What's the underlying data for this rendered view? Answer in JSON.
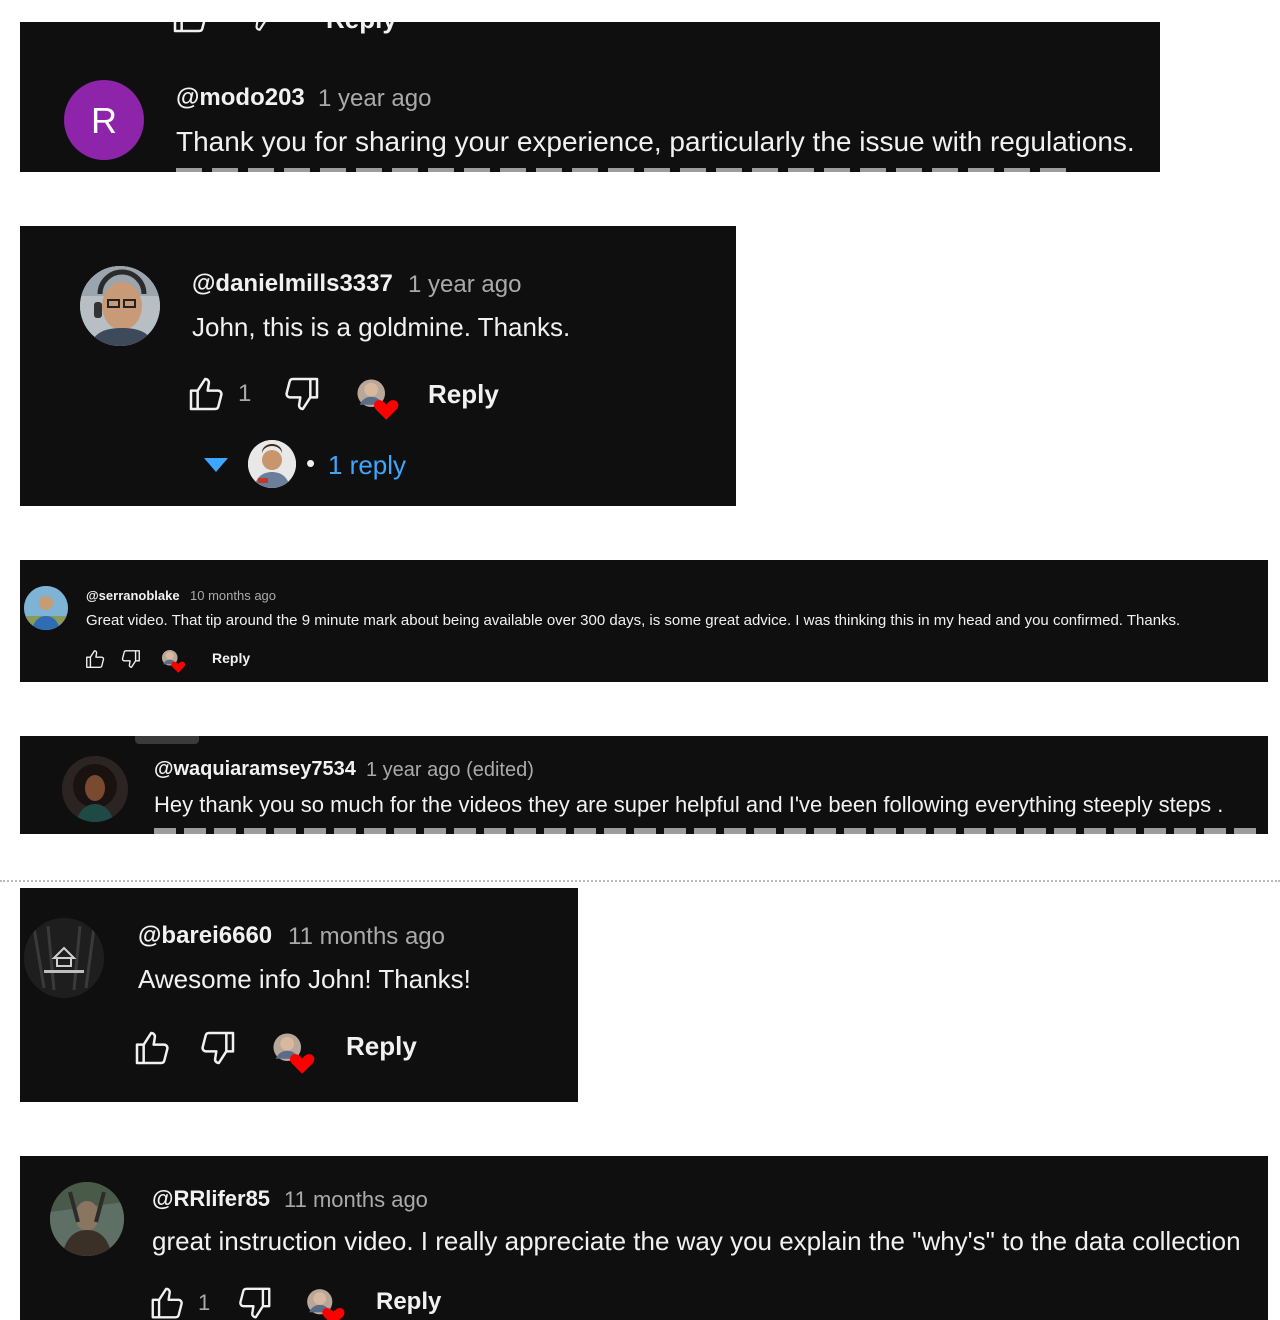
{
  "comments": [
    {
      "avatar_letter": "R",
      "avatar_color": "#8e24aa",
      "username": "@modo203",
      "timestamp": "1 year ago",
      "text": "Thank you for sharing your experience, particularly the issue with regulations.",
      "top_reply_label": "Reply"
    },
    {
      "username": "@danielmills3337",
      "timestamp": "1 year ago",
      "text": "John, this is a goldmine. Thanks.",
      "like_count": "1",
      "reply_label": "Reply",
      "replies_label": "1 reply",
      "separator": "•"
    },
    {
      "username": "@serranoblake",
      "timestamp": "10 months ago",
      "text": "Great video. That tip around the 9 minute mark about being available over 300 days, is some great advice. I was thinking this in my head and you confirmed. Thanks.",
      "reply_label": "Reply"
    },
    {
      "username": "@waquiaramsey7534",
      "timestamp": "1 year ago (edited)",
      "text": "Hey thank you so much for the videos they are super helpful and I've been following everything steeply steps ."
    },
    {
      "username": "@barei6660",
      "timestamp": "11 months ago",
      "text": "Awesome info John! Thanks!",
      "reply_label": "Reply"
    },
    {
      "username": "@RRlifer85",
      "timestamp": "11 months ago",
      "text": "great instruction video. I really appreciate the way you explain the \"why's\" to the data collection",
      "like_count": "1",
      "reply_label": "Reply"
    }
  ],
  "colors": {
    "panel_bg": "#0f0f0f",
    "text": "#f1f1f1",
    "muted": "#aaaaaa",
    "link_blue": "#3ea6ff",
    "heart_red": "#ff0000"
  },
  "icons": [
    "thumbs-up-icon",
    "thumbs-down-icon",
    "creator-heart-icon",
    "chevron-down-icon"
  ]
}
